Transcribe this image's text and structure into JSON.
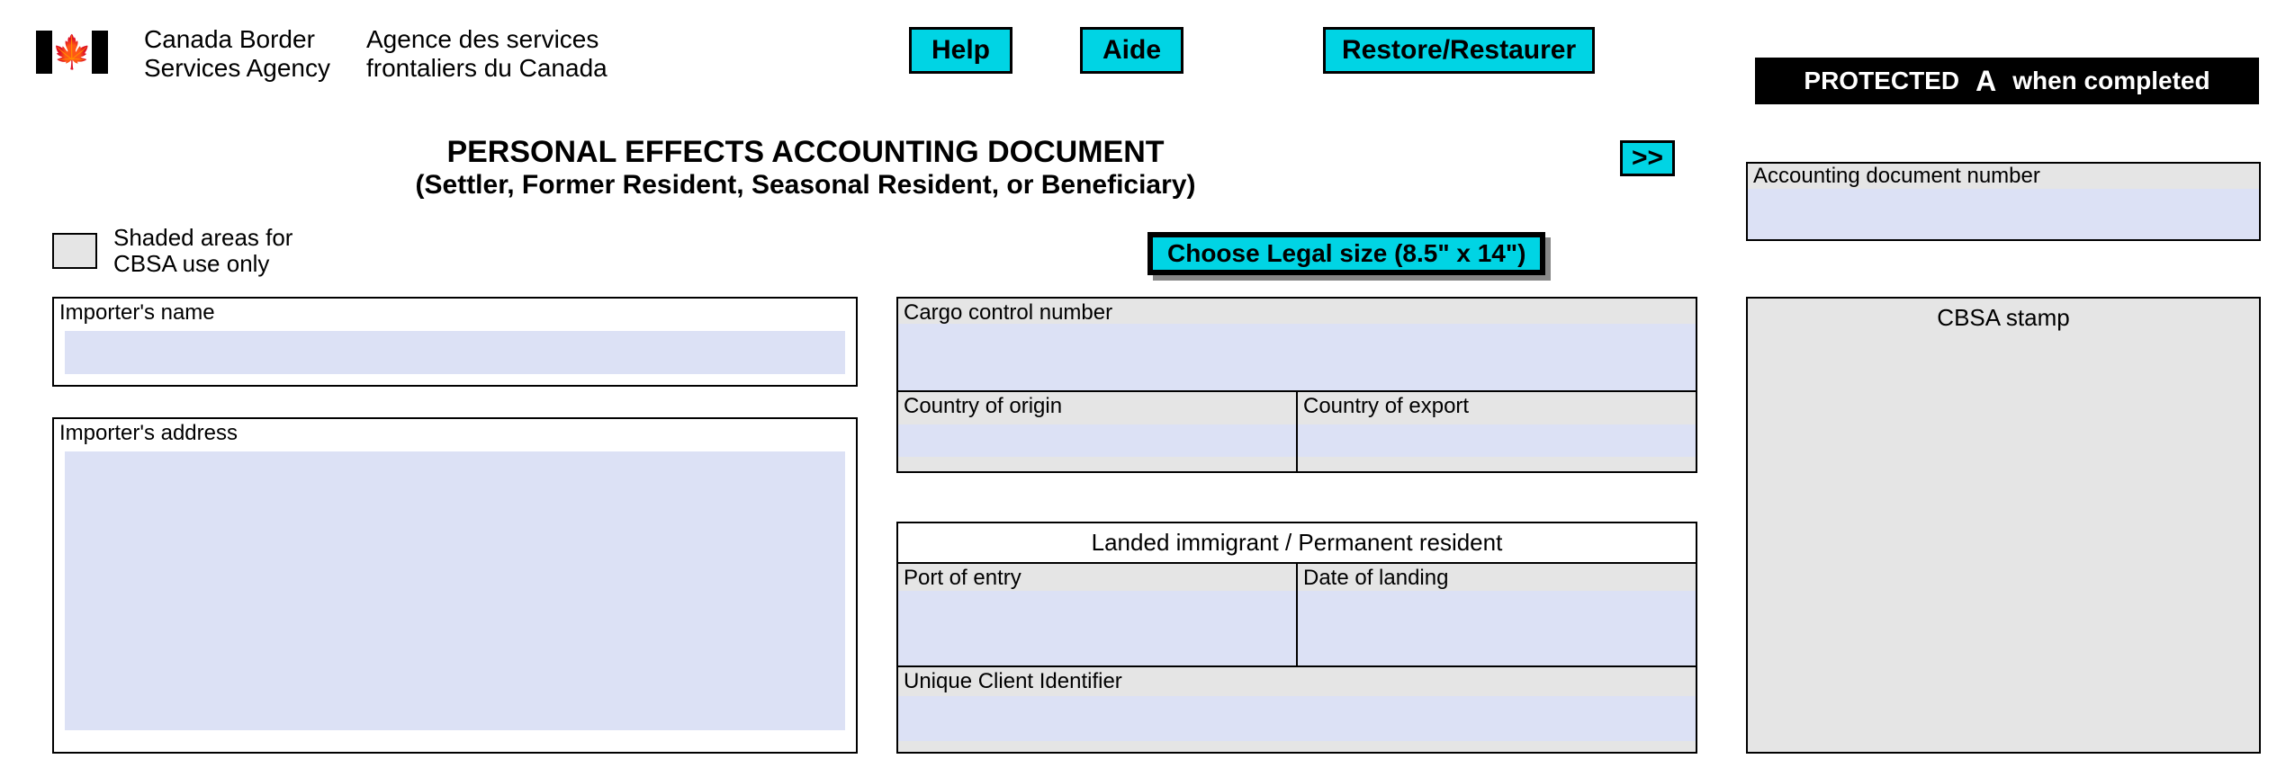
{
  "agency": {
    "en_line1": "Canada Border",
    "en_line2": "Services Agency",
    "fr_line1": "Agence des services",
    "fr_line2": "frontaliers du Canada"
  },
  "buttons": {
    "help": "Help",
    "aide": "Aide",
    "restore": "Restore/Restaurer",
    "arrow": ">>",
    "legal_size": "Choose Legal size (8.5\" x 14\")"
  },
  "protected": {
    "word": "PROTECTED",
    "letter": "A",
    "suffix": "when completed"
  },
  "title": {
    "main": "PERSONAL EFFECTS ACCOUNTING DOCUMENT",
    "sub": "(Settler, Former Resident, Seasonal Resident, or Beneficiary)"
  },
  "shaded_note": "Shaded areas for\nCBSA use only",
  "fields": {
    "acct_number": "Accounting document number",
    "importer_name": "Importer's name",
    "importer_address": "Importer's address",
    "cargo_control": "Cargo control number",
    "country_origin": "Country of origin",
    "country_export": "Country of export",
    "landed_header": "Landed immigrant / Permanent resident",
    "port_entry": "Port of entry",
    "date_landing": "Date of landing",
    "uci": "Unique Client Identifier",
    "cbsa_stamp": "CBSA stamp"
  }
}
